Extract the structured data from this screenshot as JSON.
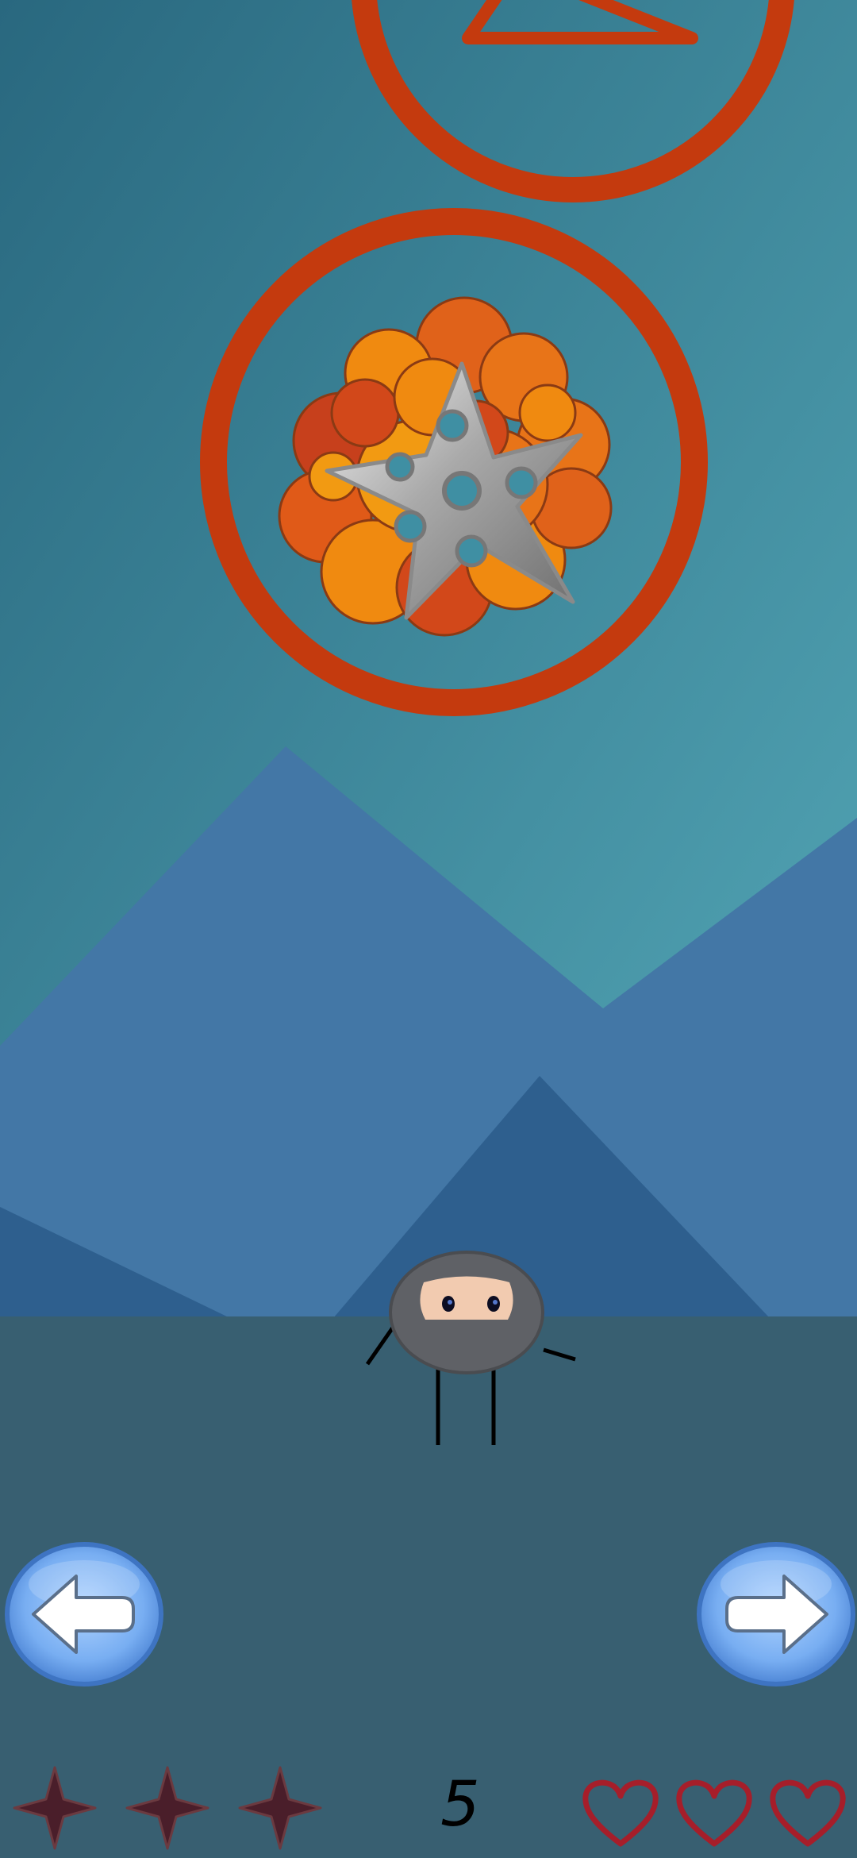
{
  "hud": {
    "score": "5",
    "shurikens_remaining": 3,
    "lives_remaining": 3
  },
  "controls": {
    "left_button_icon": "left-arrow-icon",
    "right_button_icon": "right-arrow-icon"
  },
  "targets": [
    {
      "shape": "triangle",
      "ring_color": "#C43A0E"
    },
    {
      "shape": "exploding-shuriken",
      "ring_color": "#C43A0E"
    }
  ],
  "colors": {
    "sky_top": "#2C6F85",
    "sky_bottom": "#4A9BAE",
    "mountain_front": "#4377A6",
    "mountain_back": "#2E5F8E",
    "ground": "#385F71",
    "ring": "#C43A0E",
    "heart": "#A61E2A",
    "shuriken_hud": "#4A1E2A"
  }
}
